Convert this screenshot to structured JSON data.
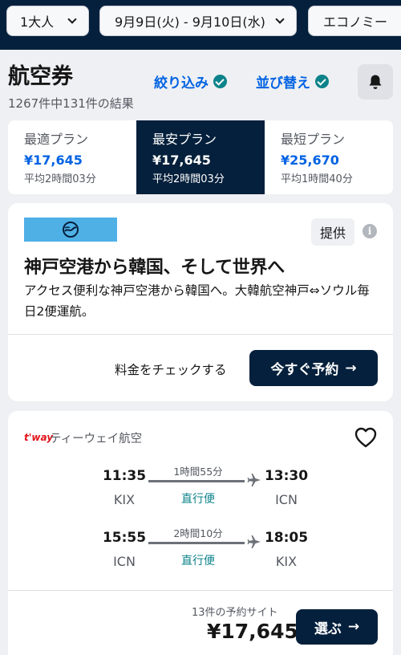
{
  "search": {
    "travelers": "1大人",
    "dates": "9月9日(火) - 9月10日(水)",
    "cabin": "エコノミー"
  },
  "header": {
    "title": "航空券",
    "result_count": "1267件中131件の結果",
    "filter_label": "絞り込み",
    "sort_label": "並び替え"
  },
  "plans": [
    {
      "name": "最適プラン",
      "price": "¥17,645",
      "avg_time": "平均2時間03分"
    },
    {
      "name": "最安プラン",
      "price": "¥17,645",
      "avg_time": "平均2時間03分"
    },
    {
      "name": "最短プラン",
      "price": "¥25,670",
      "avg_time": "平均1時間40分"
    }
  ],
  "ad": {
    "badge": "提供",
    "title": "神戸空港から韓国、そして世界へ",
    "description": "アクセス便利な神戸空港から韓国へ。大韓航空神戸⇔ソウル毎日2便運航。",
    "check_text": "料金をチェックする",
    "cta": "今すぐ予約",
    "logo_color": "#4fb0e6"
  },
  "flight": {
    "airline_logo": "t'way",
    "airline": "ティーウェイ航空",
    "legs": [
      {
        "dep_time": "11:35",
        "dep_code": "KIX",
        "duration": "1時間55分",
        "stops": "直行便",
        "arr_time": "13:30",
        "arr_code": "ICN"
      },
      {
        "dep_time": "15:55",
        "dep_code": "ICN",
        "duration": "2時間10分",
        "stops": "直行便",
        "arr_time": "18:05",
        "arr_code": "KIX"
      }
    ],
    "sites": "13件の予約サイト",
    "price": "¥17,645",
    "select": "選ぶ"
  },
  "colors": {
    "navy": "#05203c",
    "link_blue": "#0062e3",
    "teal": "#0c838a"
  }
}
